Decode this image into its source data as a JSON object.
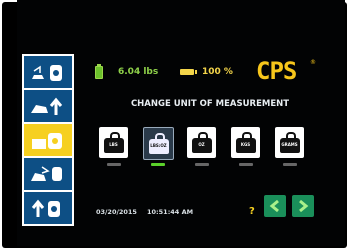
{
  "header": {
    "weight": "6.04 lbs",
    "battery_percent": "100 %",
    "logo": "CPS",
    "logo_mark": "®"
  },
  "title": "CHANGE UNIT OF MEASUREMENT",
  "units": [
    {
      "label": "LBS",
      "selected": false
    },
    {
      "label": "LBS:OZ",
      "selected": true
    },
    {
      "label": "OZ",
      "selected": false
    },
    {
      "label": "KGS",
      "selected": false
    },
    {
      "label": "GRAMS",
      "selected": false
    }
  ],
  "footer": {
    "date": "03/20/2015",
    "time": "10:51:44 AM",
    "help": "?"
  },
  "sidebar": {
    "items": [
      {
        "icon": "scale-tank-down-icon",
        "active": false
      },
      {
        "icon": "car-up-arrow-icon",
        "active": false
      },
      {
        "icon": "settings-scale-icon",
        "active": true
      },
      {
        "icon": "car-transfer-icon",
        "active": false
      },
      {
        "icon": "tank-up-arrow-icon",
        "active": false
      }
    ]
  },
  "colors": {
    "sidebar_blue": "#0d4f85",
    "active_yellow": "#f6d021",
    "weight_green": "#8fd14a",
    "nav_green": "#1a8f5a",
    "logo_yellow": "#f7c61b"
  }
}
